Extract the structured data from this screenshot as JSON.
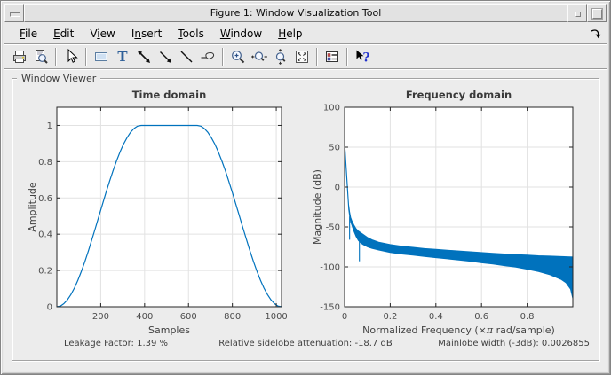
{
  "window": {
    "title": "Figure 1: Window Visualization Tool"
  },
  "menu": {
    "items": [
      {
        "label": "File",
        "u": 0
      },
      {
        "label": "Edit",
        "u": 0
      },
      {
        "label": "View",
        "u": 1
      },
      {
        "label": "Insert",
        "u": 1
      },
      {
        "label": "Tools",
        "u": 0
      },
      {
        "label": "Window",
        "u": 0
      },
      {
        "label": "Help",
        "u": 0
      }
    ]
  },
  "toolbar": {
    "groups": [
      [
        "print",
        "print-preview"
      ],
      [
        "edit-plot-pointer"
      ],
      [
        "insert-rectangle",
        "insert-text",
        "insert-double-arrow",
        "insert-arrow",
        "insert-line",
        "pin"
      ],
      [
        "zoom-in",
        "zoom-x",
        "zoom-y",
        "restore-view"
      ],
      [
        "legend"
      ],
      [
        "whats-this"
      ]
    ]
  },
  "group": {
    "label": "Window Viewer"
  },
  "status": {
    "leakage": "Leakage Factor: 1.39 %",
    "sidelobe": "Relative sidelobe attenuation: -18.7 dB",
    "mainlobe": "Mainlobe width (-3dB): 0.0026855"
  },
  "colors": {
    "accent_blue": "#0072BD",
    "client_bg": "#ececec",
    "axis": "#262626",
    "grid": "#e2e2e2",
    "tick_text": "#4d4d4d",
    "title_text": "#3a3a3a"
  },
  "chart_data": [
    {
      "name": "time-domain",
      "type": "line",
      "title": "Time domain",
      "xlabel": "Samples",
      "ylabel": "Amplitude",
      "xlim": [
        0,
        1024
      ],
      "ylim": [
        0,
        1.1
      ],
      "xticks": [
        200,
        400,
        600,
        800,
        1000
      ],
      "yticks": [
        0,
        0.2,
        0.4,
        0.6,
        0.8,
        1
      ],
      "grid": true,
      "line_color": "#0072BD",
      "x": [
        0,
        16,
        32,
        48,
        64,
        80,
        96,
        112,
        128,
        144,
        160,
        176,
        192,
        208,
        224,
        240,
        256,
        272,
        288,
        304,
        320,
        336,
        352,
        368,
        384,
        400,
        416,
        432,
        448,
        464,
        480,
        496,
        512,
        528,
        544,
        560,
        576,
        592,
        608,
        624,
        640,
        656,
        672,
        688,
        704,
        720,
        736,
        752,
        768,
        784,
        800,
        816,
        832,
        848,
        864,
        880,
        896,
        912,
        928,
        944,
        960,
        976,
        992,
        1008,
        1024
      ],
      "y": [
        0,
        0.004,
        0.017,
        0.038,
        0.067,
        0.103,
        0.146,
        0.196,
        0.25,
        0.309,
        0.371,
        0.435,
        0.5,
        0.565,
        0.629,
        0.691,
        0.75,
        0.804,
        0.854,
        0.897,
        0.933,
        0.962,
        0.983,
        0.996,
        1,
        1,
        1,
        1,
        1,
        1,
        1,
        1,
        1,
        1,
        1,
        1,
        1,
        1,
        1,
        1,
        1,
        0.996,
        0.983,
        0.962,
        0.933,
        0.897,
        0.854,
        0.804,
        0.75,
        0.691,
        0.629,
        0.565,
        0.5,
        0.435,
        0.371,
        0.309,
        0.25,
        0.196,
        0.146,
        0.103,
        0.067,
        0.038,
        0.017,
        0.004,
        0
      ]
    },
    {
      "name": "frequency-domain",
      "type": "band",
      "title": "Frequency domain",
      "xlabel": "Normalized Frequency  (×π rad/sample)",
      "ylabel": "Magnitude (dB)",
      "xlim": [
        0,
        1
      ],
      "ylim": [
        -150,
        100
      ],
      "xticks": [
        0,
        0.2,
        0.4,
        0.6,
        0.8
      ],
      "yticks": [
        -150,
        -100,
        -50,
        0,
        50,
        100
      ],
      "grid": true,
      "fill_color": "#0072BD",
      "peak_db": 55,
      "band_top": [
        [
          0,
          55
        ],
        [
          0.003,
          45
        ],
        [
          0.006,
          32
        ],
        [
          0.009,
          18
        ],
        [
          0.012,
          4
        ],
        [
          0.015,
          -10
        ],
        [
          0.018,
          -22
        ],
        [
          0.022,
          -31
        ],
        [
          0.027,
          -38
        ],
        [
          0.032,
          -42
        ],
        [
          0.04,
          -47
        ],
        [
          0.05,
          -52
        ],
        [
          0.06,
          -55
        ],
        [
          0.07,
          -57
        ],
        [
          0.08,
          -59
        ],
        [
          0.1,
          -63
        ],
        [
          0.12,
          -66
        ],
        [
          0.15,
          -69
        ],
        [
          0.2,
          -72
        ],
        [
          0.25,
          -74
        ],
        [
          0.3,
          -75.5
        ],
        [
          0.35,
          -77
        ],
        [
          0.4,
          -78
        ],
        [
          0.45,
          -79
        ],
        [
          0.5,
          -80
        ],
        [
          0.55,
          -81
        ],
        [
          0.6,
          -82
        ],
        [
          0.65,
          -83
        ],
        [
          0.7,
          -83.8
        ],
        [
          0.75,
          -84.5
        ],
        [
          0.8,
          -85.2
        ],
        [
          0.85,
          -86
        ],
        [
          0.9,
          -86.5
        ],
        [
          0.95,
          -87
        ],
        [
          1,
          -87.5
        ]
      ],
      "band_bottom": [
        [
          0,
          50
        ],
        [
          0.003,
          40
        ],
        [
          0.006,
          26
        ],
        [
          0.009,
          12
        ],
        [
          0.012,
          -2
        ],
        [
          0.015,
          -16
        ],
        [
          0.018,
          -28
        ],
        [
          0.022,
          -37
        ],
        [
          0.027,
          -44
        ],
        [
          0.032,
          -48
        ],
        [
          0.04,
          -55
        ],
        [
          0.05,
          -62
        ],
        [
          0.06,
          -67
        ],
        [
          0.07,
          -70
        ],
        [
          0.08,
          -72
        ],
        [
          0.1,
          -75
        ],
        [
          0.12,
          -77
        ],
        [
          0.15,
          -79
        ],
        [
          0.2,
          -82
        ],
        [
          0.25,
          -84
        ],
        [
          0.3,
          -85.5
        ],
        [
          0.35,
          -87
        ],
        [
          0.4,
          -88.5
        ],
        [
          0.45,
          -90
        ],
        [
          0.5,
          -91.5
        ],
        [
          0.55,
          -93
        ],
        [
          0.6,
          -95
        ],
        [
          0.65,
          -96.5
        ],
        [
          0.7,
          -98.5
        ],
        [
          0.75,
          -100.5
        ],
        [
          0.8,
          -103
        ],
        [
          0.85,
          -106
        ],
        [
          0.9,
          -110
        ],
        [
          0.95,
          -116
        ],
        [
          0.97,
          -120
        ],
        [
          0.99,
          -128
        ],
        [
          1,
          -140
        ]
      ],
      "spikes": [
        [
          0.022,
          -37,
          -66
        ],
        [
          0.065,
          -57,
          -93
        ]
      ]
    }
  ]
}
